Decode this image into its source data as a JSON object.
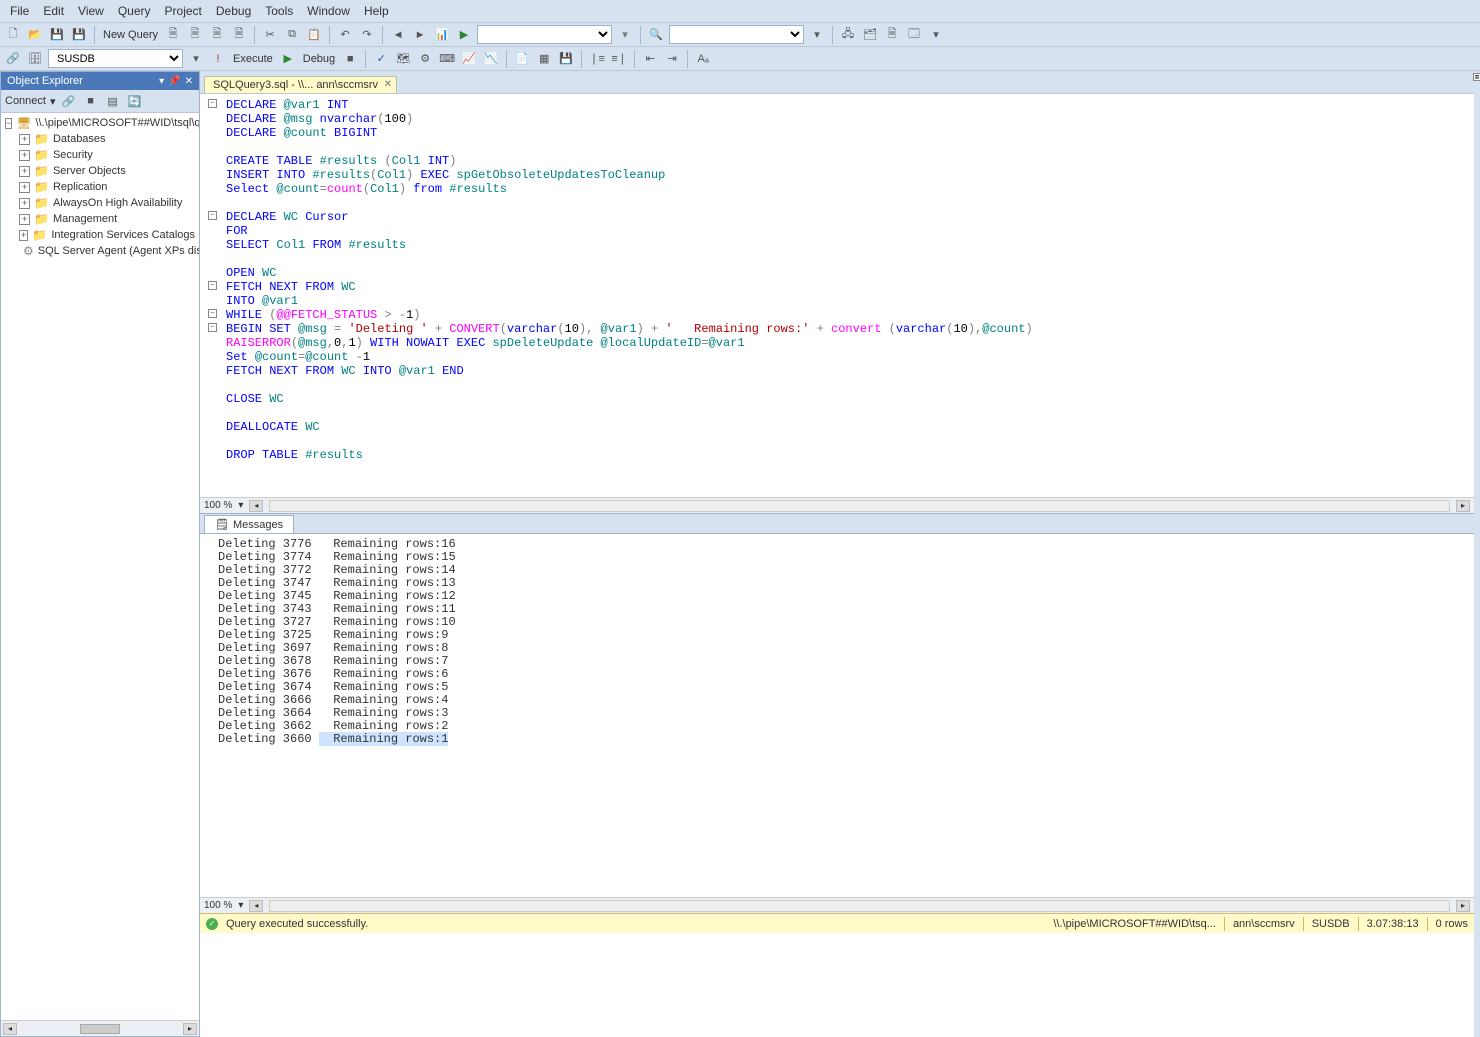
{
  "menu": [
    "File",
    "Edit",
    "View",
    "Query",
    "Project",
    "Debug",
    "Tools",
    "Window",
    "Help"
  ],
  "toolbar1": {
    "new_query": "New Query",
    "db_dropdown_width": 135
  },
  "toolbar2": {
    "db": "SUSDB",
    "execute": "Execute",
    "debug": "Debug"
  },
  "object_explorer": {
    "title": "Object Explorer",
    "connect": "Connect",
    "root": "\\\\.\\pipe\\MICROSOFT##WID\\tsql\\query",
    "nodes": [
      "Databases",
      "Security",
      "Server Objects",
      "Replication",
      "AlwaysOn High Availability",
      "Management",
      "Integration Services Catalogs"
    ],
    "agent": "SQL Server Agent (Agent XPs disabl"
  },
  "tab": {
    "label": "SQLQuery3.sql - \\\\... ann\\sccmsrv"
  },
  "zoom": "100 %",
  "messages_tab": "Messages",
  "messages": [
    {
      "id": "3776",
      "rows": "16"
    },
    {
      "id": "3774",
      "rows": "15"
    },
    {
      "id": "3772",
      "rows": "14"
    },
    {
      "id": "3747",
      "rows": "13"
    },
    {
      "id": "3745",
      "rows": "12"
    },
    {
      "id": "3743",
      "rows": "11"
    },
    {
      "id": "3727",
      "rows": "10"
    },
    {
      "id": "3725",
      "rows": "9"
    },
    {
      "id": "3697",
      "rows": "8"
    },
    {
      "id": "3678",
      "rows": "7"
    },
    {
      "id": "3676",
      "rows": "6"
    },
    {
      "id": "3674",
      "rows": "5"
    },
    {
      "id": "3666",
      "rows": "4"
    },
    {
      "id": "3664",
      "rows": "3"
    },
    {
      "id": "3662",
      "rows": "2"
    },
    {
      "id": "3660",
      "rows": "1"
    }
  ],
  "status": {
    "text": "Query executed successfully.",
    "server": "\\\\.\\pipe\\MICROSOFT##WID\\tsq...",
    "user": "ann\\sccmsrv",
    "db": "SUSDB",
    "elapsed": "3.07:38:13",
    "rows": "0 rows"
  },
  "sql": {
    "l1": {
      "a": "DECLARE ",
      "b": "@var1 ",
      "c": "INT"
    },
    "l2": {
      "a": "DECLARE ",
      "b": "@msg ",
      "c": "nvarchar",
      "d": "(",
      "e": "100",
      "f": ")"
    },
    "l3": {
      "a": "DECLARE ",
      "b": "@count ",
      "c": "BIGINT"
    },
    "l5": {
      "a": "CREATE TABLE ",
      "b": "#results ",
      "c": "(",
      "d": "Col1 ",
      "e": "INT",
      "f": ")"
    },
    "l6": {
      "a": "INSERT INTO ",
      "b": "#results",
      "c": "(",
      "d": "Col1",
      "e": ") ",
      "f": "EXEC ",
      "g": "spGetObsoleteUpdatesToCleanup"
    },
    "l7": {
      "a": "Select ",
      "b": "@count",
      "c": "=",
      "d": "count",
      "e": "(",
      "f": "Col1",
      "g": ") ",
      "h": "from ",
      "i": "#results"
    },
    "l9": {
      "a": "DECLARE ",
      "b": "WC ",
      "c": "Cursor"
    },
    "l10": {
      "a": "FOR"
    },
    "l11": {
      "a": "SELECT ",
      "b": "Col1 ",
      "c": "FROM ",
      "d": "#results"
    },
    "l13": {
      "a": "OPEN ",
      "b": "WC"
    },
    "l14": {
      "a": "FETCH NEXT FROM ",
      "b": "WC"
    },
    "l15": {
      "a": "INTO ",
      "b": "@var1"
    },
    "l16": {
      "a": "WHILE ",
      "b": "(",
      "c": "@@FETCH_STATUS ",
      "d": "> -",
      "e": "1",
      "f": ")"
    },
    "l17": {
      "a": "BEGIN ",
      "b": "SET ",
      "c": "@msg ",
      "d": "= ",
      "e": "'Deleting '",
      "f": " + ",
      "g": "CONVERT",
      "h": "(",
      "i": "varchar",
      "j": "(",
      "k": "10",
      "l": "), ",
      "m": "@var1",
      "n": ") + ",
      "o": "'   Remaining rows:'",
      "p": " + ",
      "q": "convert ",
      "r": "(",
      "s": "varchar",
      "t": "(",
      "u": "10",
      "v": "),",
      "w": "@count",
      "x": ")"
    },
    "l18": {
      "a": "RAISERROR",
      "b": "(",
      "c": "@msg",
      "d": ",",
      "e": "0",
      "f": ",",
      "g": "1",
      "h": ") ",
      "i": "WITH NOWAIT ",
      "j": "EXEC ",
      "k": "spDeleteUpdate ",
      "l": "@localUpdateID",
      "m": "=",
      "n": "@var1"
    },
    "l19": {
      "a": "Set ",
      "b": "@count",
      "c": "=",
      "d": "@count ",
      "e": "-",
      "f": "1"
    },
    "l20": {
      "a": "FETCH NEXT FROM ",
      "b": "WC ",
      "c": "INTO ",
      "d": "@var1 ",
      "e": "END"
    },
    "l22": {
      "a": "CLOSE ",
      "b": "WC"
    },
    "l24": {
      "a": "DEALLOCATE ",
      "b": "WC"
    },
    "l26": {
      "a": "DROP TABLE ",
      "b": "#results"
    }
  }
}
